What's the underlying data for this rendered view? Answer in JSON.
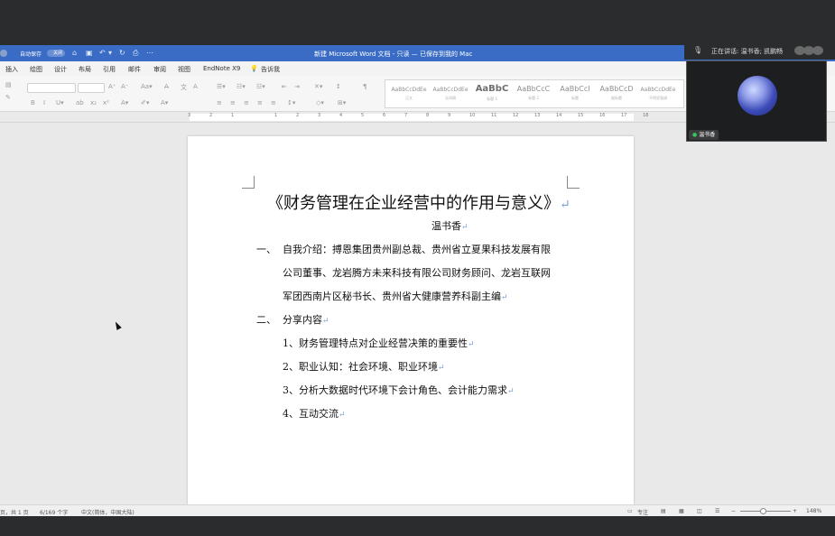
{
  "word": {
    "titlebar": {
      "autosave_label": "自动保存",
      "autosave_state": "关闭",
      "document_title": "新建 Microsoft Word 文档 - 只读 — 已保存到我的 Mac"
    },
    "menu": [
      "插入",
      "绘图",
      "设计",
      "布局",
      "引用",
      "邮件",
      "审阅",
      "视图",
      "EndNote X9",
      "告诉我"
    ],
    "styles": [
      {
        "sample": "AaBbCcDdEe",
        "name": "正文"
      },
      {
        "sample": "AaBbCcDdEe",
        "name": "无间隔"
      },
      {
        "sample": "AaBbC",
        "name": "标题 1"
      },
      {
        "sample": "AaBbCcC",
        "name": "标题 2"
      },
      {
        "sample": "AaBbCcI",
        "name": "标题"
      },
      {
        "sample": "AaBbCcD",
        "name": "副标题"
      },
      {
        "sample": "AaBbCcDdEe",
        "name": "不明显强调"
      }
    ],
    "ruler_numbers": [
      "3",
      "2",
      "1",
      "1",
      "2",
      "3",
      "4",
      "5",
      "6",
      "7",
      "8",
      "9",
      "10",
      "11",
      "12",
      "13",
      "14",
      "15",
      "16",
      "17",
      "18"
    ],
    "document": {
      "title": "《财务管理在企业经营中的作用与意义》",
      "author": "温书香",
      "section1_number": "一、",
      "section1_lines": [
        "自我介绍：搏恩集团贵州副总裁、贵州省立夏果科技发展有限",
        "公司董事、龙岩腾方未来科技有限公司财务顾问、龙岩互联网",
        "军团西南片区秘书长、贵州省大健康营养科副主编"
      ],
      "section2_number": "二、",
      "section2_title": "分享内容",
      "items": [
        "1、财务管理特点对企业经营决策的重要性",
        "2、职业认知：社会环境、职业环境",
        "3、分析大数据时代环境下会计角色、会计能力需求",
        "4、互动交流"
      ],
      "paragraph_mark": "↵"
    },
    "status": {
      "page": "页，共 1 页",
      "words": "6/169 个字",
      "language": "中文(简体，中国大陆)",
      "focus": "专注",
      "zoom_minus": "−",
      "zoom_plus": "+",
      "zoom": "148%",
      "zoom_fraction": 0.46
    }
  },
  "meeting": {
    "speaking": "正在讲话: 温书香; 凯鹏畅",
    "participant_name": "温书香"
  }
}
